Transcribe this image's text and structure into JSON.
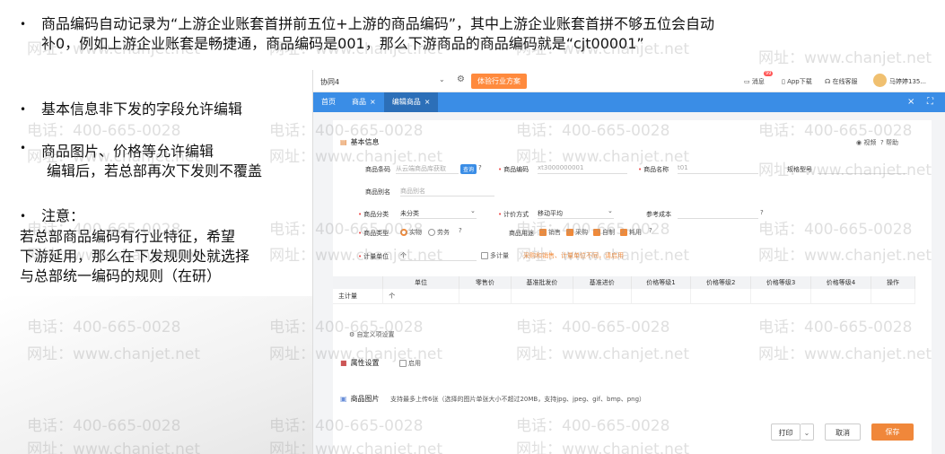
{
  "slide": {
    "bullet1_line1": "商品编码自动记录为“上游企业账套首拼前五位+上游的商品编码”，其中上游企业账套首拼不够五位会自动",
    "bullet1_line2": "补0，例如上游企业账套是畅捷通，商品编码是001，那么下游商品的商品编码就是“cjt00001”",
    "bullet2": "基本信息非下发的字段允许编辑",
    "bullet3_line1": "商品图片、价格等允许编辑",
    "bullet3_line2": "编辑后，若总部再次下发则不覆盖",
    "bullet4_title": "注意：",
    "note_line1": "若总部商品编码有行业特征，希望",
    "note_line2": "下游延用，那么在下发规则处就选择",
    "note_line3": "与总部统一编码的规则（在研）",
    "bullet_glyph": "•"
  },
  "watermark": {
    "phone": "电话：400-665-0028",
    "site": "网址：www.chanjet.net"
  },
  "app": {
    "org": "协同4",
    "industry_button": "体验行业方案",
    "message": "消息",
    "message_badge": "99",
    "app_download": "App下载",
    "online_service": "在线客服",
    "user": "马婷婷135...",
    "tabs": [
      {
        "label": "首页"
      },
      {
        "label": "商品"
      },
      {
        "label": "编辑商品"
      }
    ],
    "close_glyph": "×",
    "form": {
      "basic_info": "基本信息",
      "video": "视频",
      "help": "帮助",
      "barcode_label": "商品条码",
      "barcode_placeholder": "从云端商品库获取",
      "query_button": "查询",
      "code_label": "商品编码",
      "code_value": "xt3000000001",
      "name_label": "商品名称",
      "name_value": "t01",
      "spec_label": "规格型号",
      "alias_label": "商品别名",
      "alias_placeholder": "商品别名",
      "category_label": "商品分类",
      "category_value": "未分类",
      "costing_label": "计价方式",
      "costing_value": "移动平均",
      "ref_cost_label": "参考成本",
      "type_label": "商品类型",
      "type_goods": "实物",
      "type_service": "劳务",
      "usage_label": "商品用途",
      "usage_sale": "销售",
      "usage_purchase": "采购",
      "usage_self": "自制",
      "usage_consume": "耗用",
      "unit_label": "计量单位",
      "unit_value": "个",
      "multi_unit": "多计量",
      "unit_warning": "采购和销售、计量单位不同，请启用",
      "table_headers": [
        "",
        "单位",
        "零售价",
        "基准批发价",
        "基准进价",
        "价格等级1",
        "价格等级2",
        "价格等级3",
        "价格等级4",
        "操作"
      ],
      "table_row": [
        "主计量",
        "个",
        "",
        "",
        "",
        "",
        "",
        "",
        "",
        ""
      ],
      "custom_items": "自定义项设置",
      "attr_settings": "属性设置",
      "enable": "启用",
      "images_label": "商品图片",
      "images_hint": "支持最多上传6张（选择的图片单张大小不超过20MB，支持jpg、jpeg、gif、bmp、png）"
    },
    "footer": {
      "print": "打印",
      "cancel": "取消",
      "save": "保存"
    }
  },
  "colors": {
    "accent": "#3a8de6",
    "orange": "#ff8a3d"
  }
}
